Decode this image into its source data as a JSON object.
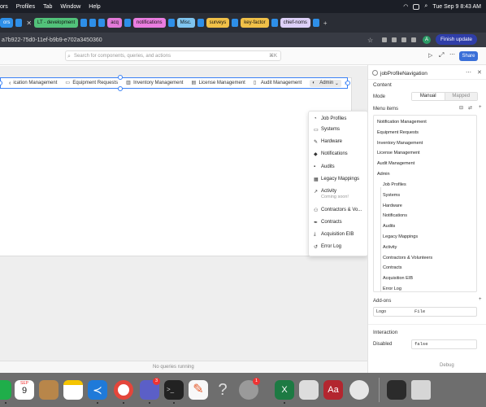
{
  "menubar": {
    "app_fragment": "ors",
    "items": [
      "Profiles",
      "Tab",
      "Window",
      "Help"
    ],
    "clock": "Tue Sep 9  8:43 AM"
  },
  "tabs": [
    {
      "label": "ors",
      "color": "#2e8fe8"
    },
    {
      "label": "LT - development",
      "color": "#52c27a"
    },
    {
      "label": "acq",
      "color": "#e27ad8"
    },
    {
      "label": "notifications",
      "color": "#ea7de0"
    },
    {
      "label": "Misc.",
      "color": "#7fc4ef"
    },
    {
      "label": "surveys",
      "color": "#f0c048"
    },
    {
      "label": "key-factor",
      "color": "#f0c048"
    },
    {
      "label": "chief-noms",
      "color": "#dccff7"
    }
  ],
  "address_bar": {
    "url": "a7b922-75d0-11ef-b9b9-e702a3450360",
    "profile_initial": "A",
    "finish_update": "Finish update"
  },
  "toolbar": {
    "search_placeholder": "Search for components, queries, and actions",
    "search_shortcut": "⌘K",
    "share": "Share"
  },
  "nav": {
    "items": [
      {
        "label": "ication Management",
        "icon": "bell-icon"
      },
      {
        "label": "Equipment Requests",
        "icon": "monitor-icon"
      },
      {
        "label": "Inventory Management",
        "icon": "chart-icon"
      },
      {
        "label": "License Management",
        "icon": "lock-icon"
      },
      {
        "label": "Audit Management",
        "icon": "doc-icon"
      }
    ],
    "admin_label": "Admin"
  },
  "dropdown": {
    "items": [
      {
        "label": "Job Profiles",
        "icon": "person-icon"
      },
      {
        "label": "Systems",
        "icon": "monitor-icon"
      },
      {
        "label": "Hardware",
        "icon": "wrench-icon"
      },
      {
        "label": "Notifications",
        "icon": "bell-icon"
      },
      {
        "label": "Audits",
        "icon": "clipboard-icon"
      },
      {
        "label": "Legacy Mappings",
        "icon": "map-icon"
      },
      {
        "label": "Activity",
        "icon": "activity-icon",
        "sub": "Coming soon!"
      },
      {
        "label": "Contractors & Vo...",
        "icon": "people-icon"
      },
      {
        "label": "Contracts",
        "icon": "pen-icon"
      },
      {
        "label": "Acquisition EIB",
        "icon": "download-icon"
      },
      {
        "label": "Error Log",
        "icon": "history-icon"
      }
    ]
  },
  "panel": {
    "title": "jobProfileNavigation",
    "content_heading": "Content",
    "mode_label": "Mode",
    "mode_options": [
      "Manual",
      "Mapped"
    ],
    "menu_items_label": "Menu items",
    "menu_items": [
      "Notification Management",
      "Equipment Requests",
      "Inventory Management",
      "License Management",
      "Audit Management",
      "Admin"
    ],
    "admin_children": [
      "Job Profiles",
      "Systems",
      "Hardware",
      "Notifications",
      "Audits",
      "Legacy Mappings",
      "Activity",
      "Contractors & Volunteers",
      "Contracts",
      "Acquisition EIB",
      "Error Log"
    ],
    "addons_label": "Add-ons",
    "logo_label": "Logo",
    "logo_value": "File",
    "interaction_heading": "Interaction",
    "disabled_label": "Disabled",
    "disabled_value": "false"
  },
  "status": {
    "queries": "No queries running",
    "debug": "Debug"
  },
  "dock": {
    "calendar_month": "SEP",
    "calendar_day": "9",
    "teams_badge": "3",
    "settings_badge": "1"
  }
}
